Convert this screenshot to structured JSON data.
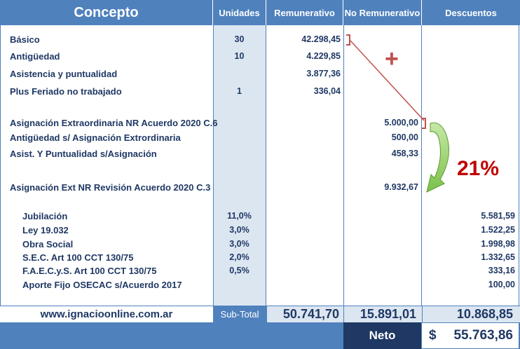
{
  "headers": {
    "concepto": "Concepto",
    "unidades": "Unidades",
    "remunerativo": "Remunerativo",
    "no_remunerativo": "No Remunerativo",
    "descuentos": "Descuentos"
  },
  "rows": [
    {
      "label": "Básico",
      "unidades": "30",
      "remunerativo": "42.298,45"
    },
    {
      "label": "Antigüedad",
      "unidades": "10",
      "remunerativo": "4.229,85"
    },
    {
      "label": "Asistencia y puntualidad",
      "remunerativo": "3.877,36"
    },
    {
      "label": "Plus Feriado no trabajado",
      "unidades": "1",
      "remunerativo": "336,04"
    },
    {
      "label": "Asignación Extraordinaria NR Acuerdo 2020 C.6",
      "no_remunerativo": "5.000,00"
    },
    {
      "label": "Antigüedad s/ Asignación  Extrordinaria",
      "no_remunerativo": "500,00"
    },
    {
      "label": "Asist. Y Puntualidad s/Asignación",
      "no_remunerativo": "458,33"
    },
    {
      "label": "Asignación Ext NR Revisión Acuerdo 2020 C.3",
      "no_remunerativo": "9.932,67"
    },
    {
      "label": "Jubilación",
      "unidades": "11,0%",
      "descuentos": "5.581,59"
    },
    {
      "label": "Ley 19.032",
      "unidades": "3,0%",
      "descuentos": "1.522,25"
    },
    {
      "label": "Obra Social",
      "unidades": "3,0%",
      "descuentos": "1.998,98"
    },
    {
      "label": "S.E.C. Art 100 CCT 130/75",
      "unidades": "2,0%",
      "descuentos": "1.332,65"
    },
    {
      "label": "F.A.E.C.y.S. Art 100 CCT 130/75",
      "unidades": "0,5%",
      "descuentos": "333,16"
    },
    {
      "label": "Aporte Fijo OSECAC s/Acuerdo 2017",
      "descuentos": "100,00"
    }
  ],
  "annotations": {
    "plus": "+",
    "percent": "21%",
    "colors": {
      "line": "#c0504d",
      "arrow": "#92d050",
      "percent": "#c00000"
    }
  },
  "footer": {
    "website": "www.ignacioonline.com.ar",
    "subtotal_label": "Sub-Total",
    "subtotal_remunerativo": "50.741,70",
    "subtotal_no_remunerativo": "15.891,01",
    "subtotal_descuentos": "10.868,85",
    "neto_label": "Neto",
    "neto_currency": "$",
    "neto_value": "55.763,86"
  },
  "colors": {
    "header": "#4f81bd",
    "text": "#1f3864",
    "unidades_bg": "#dce6f1",
    "neto_bg": "#1f3864"
  }
}
